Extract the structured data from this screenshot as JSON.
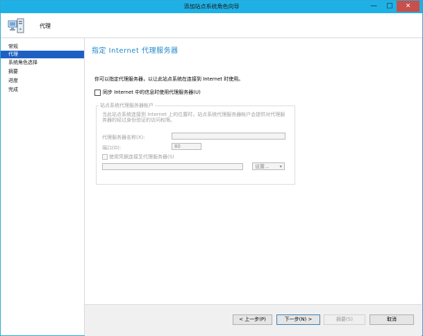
{
  "window": {
    "title": "添加站点系统角色向导"
  },
  "header": {
    "title": "代理",
    "icon": "computer-icon"
  },
  "nav": {
    "items": [
      {
        "label": "常规",
        "active": false
      },
      {
        "label": "代理",
        "active": true
      },
      {
        "label": "系统角色选择",
        "active": false
      },
      {
        "label": "摘要",
        "active": false
      },
      {
        "label": "进度",
        "active": false
      },
      {
        "label": "完成",
        "active": false
      }
    ]
  },
  "main": {
    "title": "指定 Internet 代理服务器",
    "description": "你可以指定代理服务器，以让此站点系统在连接到 Internet 时使用。",
    "sync_checkbox_label": "同步 Internet 中的信息时使用代理服务器(U)",
    "group": {
      "title": "站点系统代理服务器帐户",
      "description": "当此站点系统连接到 Internet 上的位置时，站点系统代理服务器帐户会提供对代理服务器的经过身份验证的访问权限。",
      "server_name_label": "代理服务器名称(X):",
      "server_name_value": "",
      "port_label": "端口(O):",
      "port_value": "80",
      "credentials_checkbox_label": "使用凭据连接至代理服务器(S)",
      "account_value": "",
      "settings_label": "设置...",
      "settings_arrow": "▾"
    }
  },
  "footer": {
    "back_label": "< 上一步(P)",
    "next_label": "下一步(N) >",
    "summary_label": "摘要(S)",
    "cancel_label": "取消"
  },
  "titlebar": {
    "minimize": "—",
    "maximize": "□",
    "close": "✕"
  }
}
